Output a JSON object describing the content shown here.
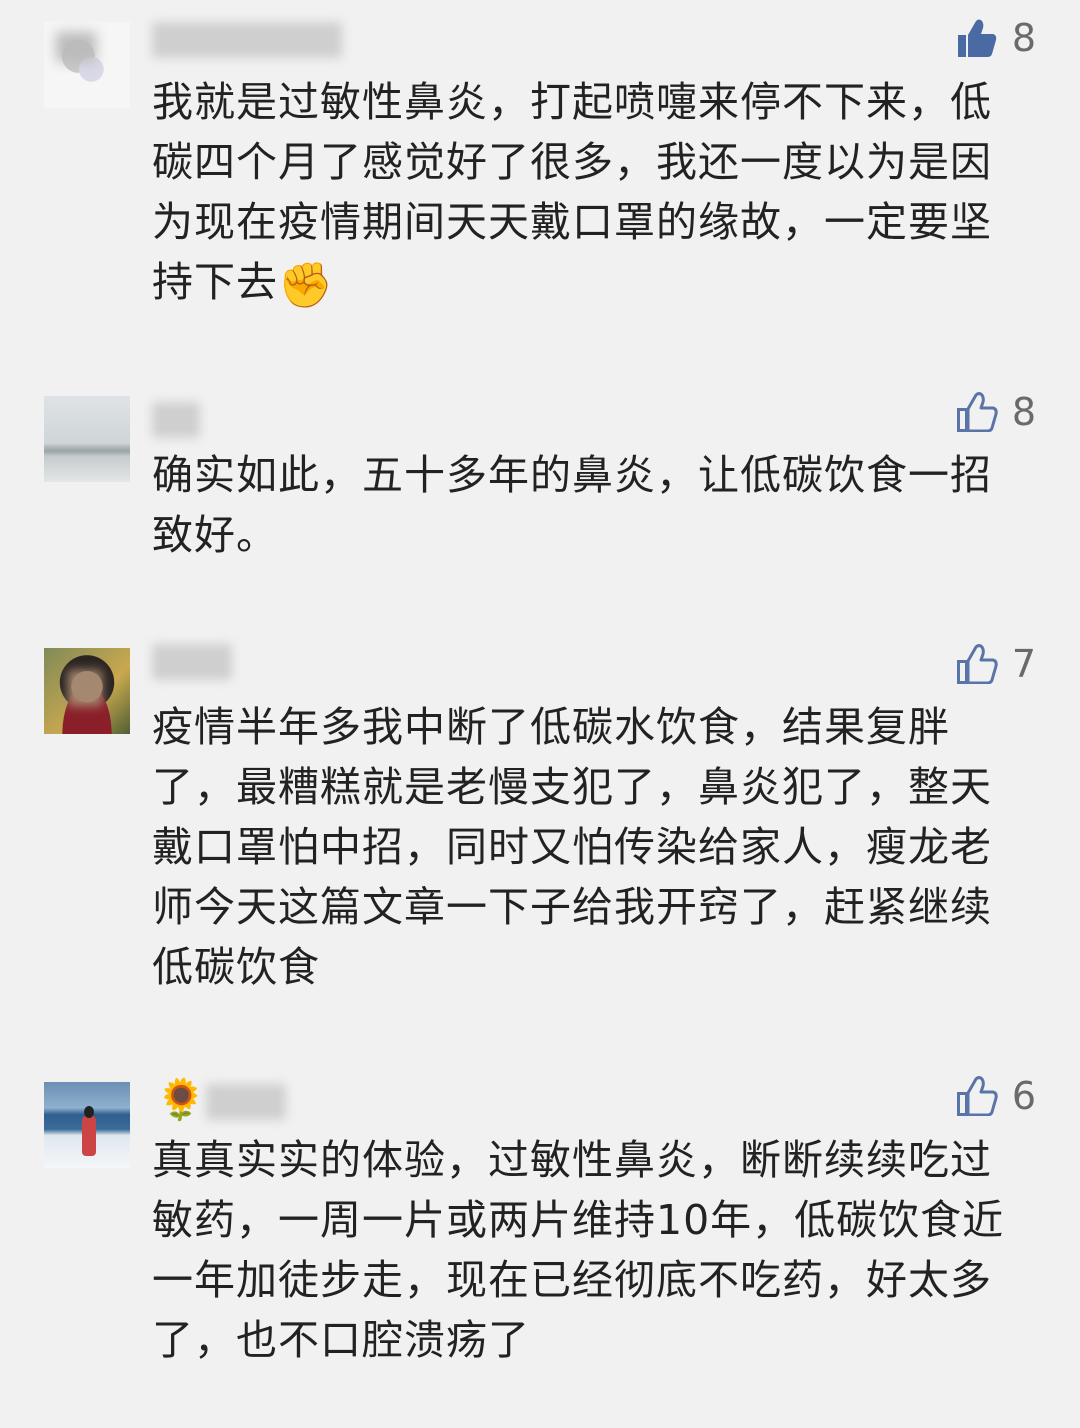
{
  "comments": [
    {
      "likes": "8",
      "liked": true,
      "text": "我就是过敏性鼻炎，打起喷嚏来停不下来，低碳四个月了感觉好了很多，我还一度以为是因为现在疫情期间天天戴口罩的缘故，一定要坚持下去",
      "emoji": "✊"
    },
    {
      "likes": "8",
      "liked": false,
      "text": "确实如此，五十多年的鼻炎，让低碳饮食一招致好。"
    },
    {
      "likes": "7",
      "liked": false,
      "text": "疫情半年多我中断了低碳水饮食，结果复胖了，最糟糕就是老慢支犯了，鼻炎犯了，整天戴口罩怕中招，同时又怕传染给家人，瘦龙老师今天这篇文章一下子给我开窍了，赶紧继续低碳饮食"
    },
    {
      "likes": "6",
      "liked": false,
      "name_emoji": "🌻",
      "text": "真真实实的体验，过敏性鼻炎，断断续续吃过敏药，一周一片或两片维持10年，低碳饮食近一年加徒步走，现在已经彻底不吃药，好太多了，也不口腔溃疡了"
    }
  ],
  "colors": {
    "background": "#f1f1f1",
    "text": "#222222",
    "like_count": "#6a6a6a",
    "like_icon_filled": "#4a6aa3",
    "like_icon_outline": "#5b74a8"
  }
}
